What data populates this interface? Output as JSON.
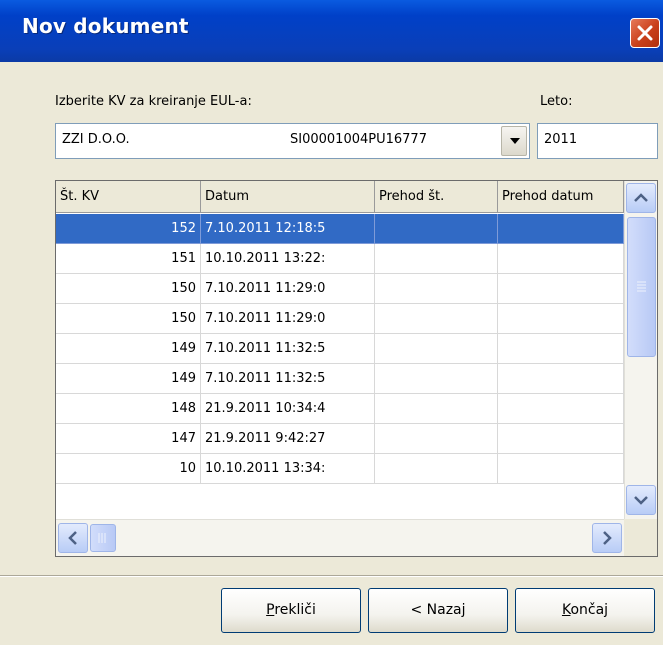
{
  "window": {
    "title": "Nov dokument"
  },
  "form": {
    "kv_label": "Izberite KV za kreiranje EUL-a:",
    "year_label": "Leto:",
    "kv_select": {
      "name": "ZZI D.O.O.",
      "code": "SI00001004PU16777"
    },
    "year_value": "2011"
  },
  "table": {
    "columns": [
      "Št. KV",
      "Datum",
      "Prehod št.",
      "Prehod datum"
    ],
    "rows": [
      {
        "kv": "152",
        "datum": "7.10.2011 12:18:5",
        "prehod_st": "",
        "prehod_datum": "",
        "selected": true
      },
      {
        "kv": "151",
        "datum": "10.10.2011 13:22:",
        "prehod_st": "",
        "prehod_datum": ""
      },
      {
        "kv": "150",
        "datum": "7.10.2011 11:29:0",
        "prehod_st": "",
        "prehod_datum": ""
      },
      {
        "kv": "150",
        "datum": "7.10.2011 11:29:0",
        "prehod_st": "",
        "prehod_datum": ""
      },
      {
        "kv": "149",
        "datum": "7.10.2011 11:32:5",
        "prehod_st": "",
        "prehod_datum": ""
      },
      {
        "kv": "149",
        "datum": "7.10.2011 11:32:5",
        "prehod_st": "",
        "prehod_datum": ""
      },
      {
        "kv": "148",
        "datum": "21.9.2011 10:34:4",
        "prehod_st": "",
        "prehod_datum": ""
      },
      {
        "kv": "147",
        "datum": "21.9.2011 9:42:27",
        "prehod_st": "",
        "prehod_datum": ""
      },
      {
        "kv": "10",
        "datum": "10.10.2011 13:34:",
        "prehod_st": "",
        "prehod_datum": ""
      }
    ]
  },
  "buttons": {
    "cancel_pre": "",
    "cancel_u": "P",
    "cancel_post": "rekliči",
    "back": "< Nazaj",
    "finish_pre": "",
    "finish_u": "K",
    "finish_post": "ončaj"
  },
  "icons": {
    "close": "close-x-icon",
    "dropdown": "chevron-down-icon",
    "scroll_up": "arrow-up-icon",
    "scroll_down": "arrow-down-icon",
    "scroll_left": "arrow-left-icon",
    "scroll_right": "arrow-right-icon"
  },
  "colors": {
    "titlebar": "#0a4fd4",
    "selection": "#316ac5",
    "close": "#d2542c",
    "dialog": "#ece9d8"
  }
}
